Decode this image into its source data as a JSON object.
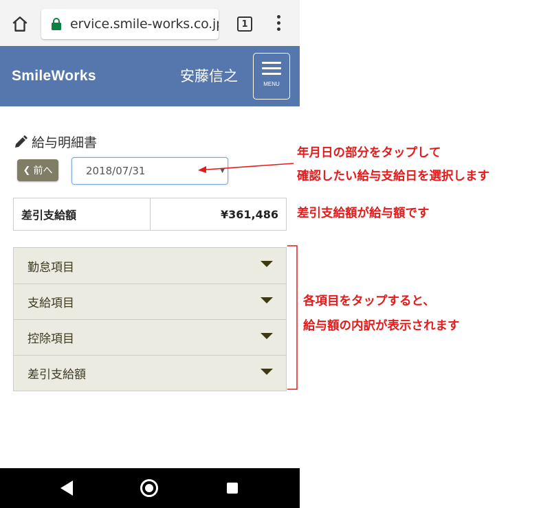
{
  "browser": {
    "url": "ervice.smile-works.co.jp",
    "tab_count": "1",
    "icons": {
      "home": "home-icon",
      "lock": "lock-icon",
      "menu": "kebab-menu-icon"
    }
  },
  "header": {
    "brand": "SmileWorks",
    "user_name": "安藤信之",
    "menu_label": "MENU",
    "bg_color": "#5677ae"
  },
  "page": {
    "title": "給与明細書",
    "prev_button": "前へ",
    "date_value": "2018/07/31",
    "net_pay_label": "差引支給額",
    "net_pay_value": "¥361,486"
  },
  "accordion": {
    "items": [
      {
        "label": "勤怠項目"
      },
      {
        "label": "支給項目"
      },
      {
        "label": "控除項目"
      },
      {
        "label": "差引支給額"
      }
    ]
  },
  "annotations": {
    "date_note_line1": "年月日の部分をタップして",
    "date_note_line2": "確認したい給与支給日を選択します",
    "amount_note": "差引支給額が給与額です",
    "items_note_line1": "各項目をタップすると、",
    "items_note_line2": "給与額の内訳が表示されます",
    "color": "#e51a1a"
  },
  "nav_bar": {
    "icons": [
      "back-icon",
      "home-circle-icon",
      "recent-apps-icon"
    ]
  }
}
